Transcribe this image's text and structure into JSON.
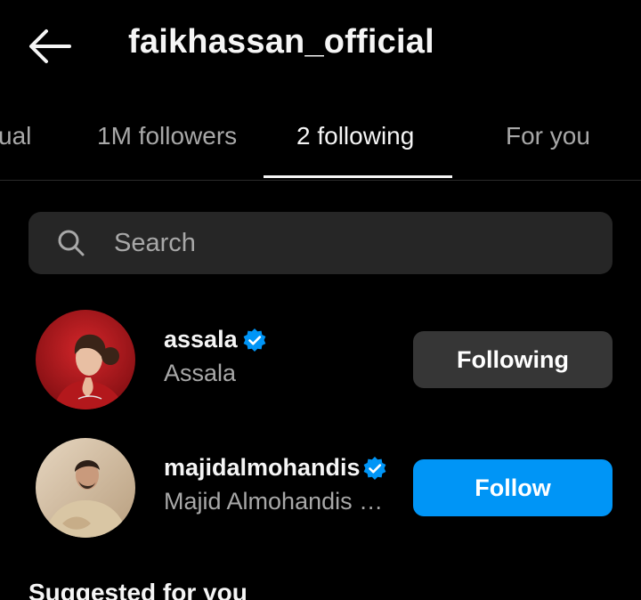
{
  "header": {
    "title": "faikhassan_official"
  },
  "tabs": [
    {
      "label": "ual"
    },
    {
      "label": "1M followers"
    },
    {
      "label": "2 following"
    },
    {
      "label": "For you"
    }
  ],
  "search": {
    "placeholder": "Search"
  },
  "accounts": [
    {
      "username": "assala",
      "full_name": "Assala",
      "verified": true,
      "button_label": "Following"
    },
    {
      "username": "majidalmohandis",
      "full_name": "Majid Almohandis Majid Almohandis",
      "verified": true,
      "button_label": "Follow"
    }
  ],
  "sections": {
    "suggested_title": "Suggested for you"
  },
  "colors": {
    "accent": "#0095f6",
    "background": "#000000",
    "button_gray": "#363636",
    "search_bg": "#262626"
  }
}
